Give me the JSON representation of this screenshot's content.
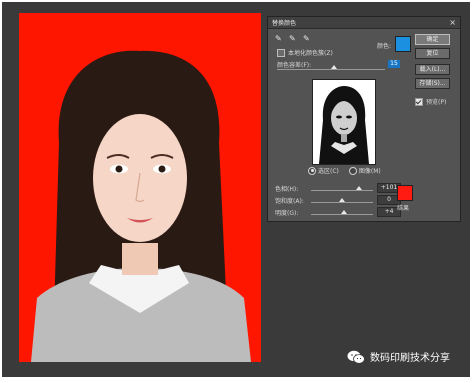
{
  "dialog": {
    "title": "替换颜色",
    "localized_label": "本地化颜色簇(Z)",
    "color_label": "颜色:",
    "fuzziness_label": "颜色容差(F):",
    "fuzziness_value": "15",
    "fuzziness_level": 0.53,
    "buttons": [
      "确定",
      "复位",
      "载入(L)...",
      "存储(S)..."
    ],
    "preview_label": "预览(P)",
    "radio_selection": "选区(C)",
    "radio_image": "图像(M)",
    "adjustments": [
      {
        "label": "色相(H):",
        "value": "+101",
        "level": 0.78
      },
      {
        "label": "饱和度(A):",
        "value": "0",
        "level": 0.5
      },
      {
        "label": "明度(G):",
        "value": "+4",
        "level": 0.53
      }
    ],
    "result_label": "结果",
    "source_color": "#1b8fe0",
    "result_color": "#ff1a12"
  },
  "watermark": {
    "text": "数码印刷技术分享",
    "icon": "wechat-icon"
  },
  "canvas": {
    "background_color": "#ff1600",
    "icon_close": "close-icon",
    "icon_eyedroppers": [
      "eyedropper-icon",
      "eyedropper-plus-icon",
      "eyedropper-minus-icon"
    ]
  }
}
